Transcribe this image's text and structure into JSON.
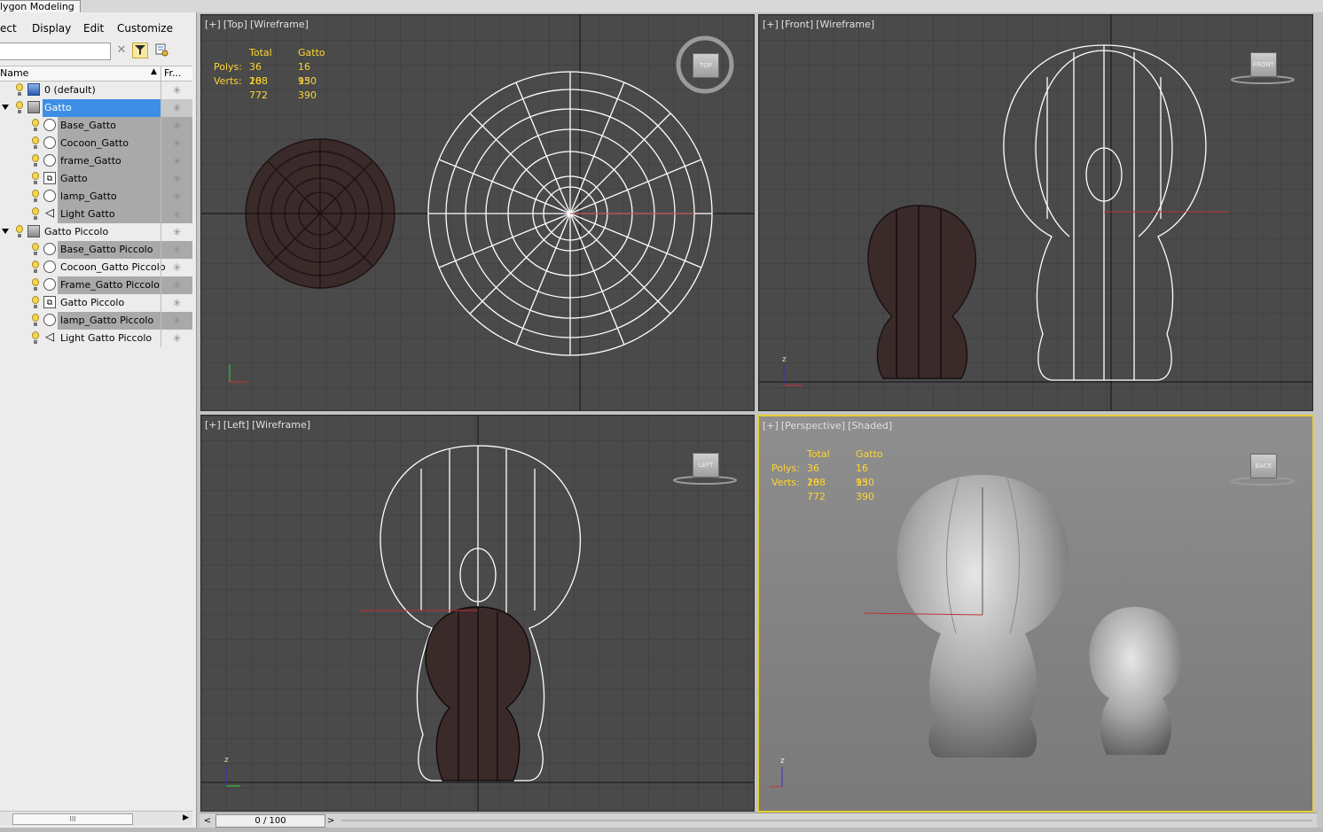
{
  "ribbon": {
    "tab_label": "lygon Modeling"
  },
  "menu": {
    "items": [
      "ect",
      "Display",
      "Edit",
      "Customize"
    ]
  },
  "toolbar": {
    "search_value": "",
    "clear_icon": "clear-filter-icon",
    "filter_icon": "filter-icon",
    "config_icon": "configure-icon"
  },
  "columns": {
    "name": "Name",
    "freeze": "Fr..."
  },
  "tree": [
    {
      "label": "0 (default)",
      "icon": "layer-default-icon",
      "level": 0
    },
    {
      "label": "Gatto",
      "icon": "layer-icon",
      "level": 0,
      "expanded": true,
      "selected": true
    },
    {
      "label": "Base_Gatto",
      "icon": "object-icon",
      "level": 1
    },
    {
      "label": "Cocoon_Gatto",
      "icon": "object-icon",
      "level": 1
    },
    {
      "label": "frame_Gatto",
      "icon": "object-icon",
      "level": 1
    },
    {
      "label": "Gatto",
      "icon": "group-icon",
      "level": 1
    },
    {
      "label": "lamp_Gatto",
      "icon": "object-icon",
      "level": 1
    },
    {
      "label": "Light Gatto",
      "icon": "light-icon",
      "level": 1
    },
    {
      "label": "Gatto Piccolo",
      "icon": "layer-icon",
      "level": 0,
      "expanded": true
    },
    {
      "label": "Base_Gatto Piccolo",
      "icon": "object-icon",
      "level": 1
    },
    {
      "label": "Cocoon_Gatto Piccolo",
      "icon": "object-icon",
      "level": 1
    },
    {
      "label": "Frame_Gatto Piccolo",
      "icon": "object-icon",
      "level": 1
    },
    {
      "label": "Gatto Piccolo",
      "icon": "group-icon",
      "level": 1
    },
    {
      "label": "lamp_Gatto Piccolo",
      "icon": "object-icon",
      "level": 1
    },
    {
      "label": "Light Gatto Piccolo",
      "icon": "light-icon",
      "level": 1
    }
  ],
  "scrollbar": {
    "grip": "III"
  },
  "viewports": {
    "top": {
      "plus": "[+]",
      "view": "[Top]",
      "mode": "[Wireframe]",
      "cube": "TOP"
    },
    "front": {
      "plus": "[+]",
      "view": "[Front]",
      "mode": "[Wireframe]",
      "cube": "FRONT"
    },
    "left": {
      "plus": "[+]",
      "view": "[Left]",
      "mode": "[Wireframe]",
      "cube": "LEFT"
    },
    "persp": {
      "plus": "[+]",
      "view": "[Perspective]",
      "mode": "[Shaded]",
      "cube": "BACK"
    }
  },
  "stats": {
    "col_total": "Total",
    "col_sel": "Gatto",
    "polys_label": "Polys:",
    "polys_total": "36 108",
    "polys_sel": "16 950",
    "verts_label": "Verts:",
    "verts_total": "28 772",
    "verts_sel": "13 390"
  },
  "axes": {
    "x": "x",
    "y": "y",
    "z": "z"
  },
  "timeslider": {
    "frame": "0 / 100",
    "prev": "<",
    "next": ">"
  },
  "colors": {
    "stats": "#ffd531",
    "selection": "#3d8fe6",
    "active_viewport": "#e4cf2c"
  }
}
